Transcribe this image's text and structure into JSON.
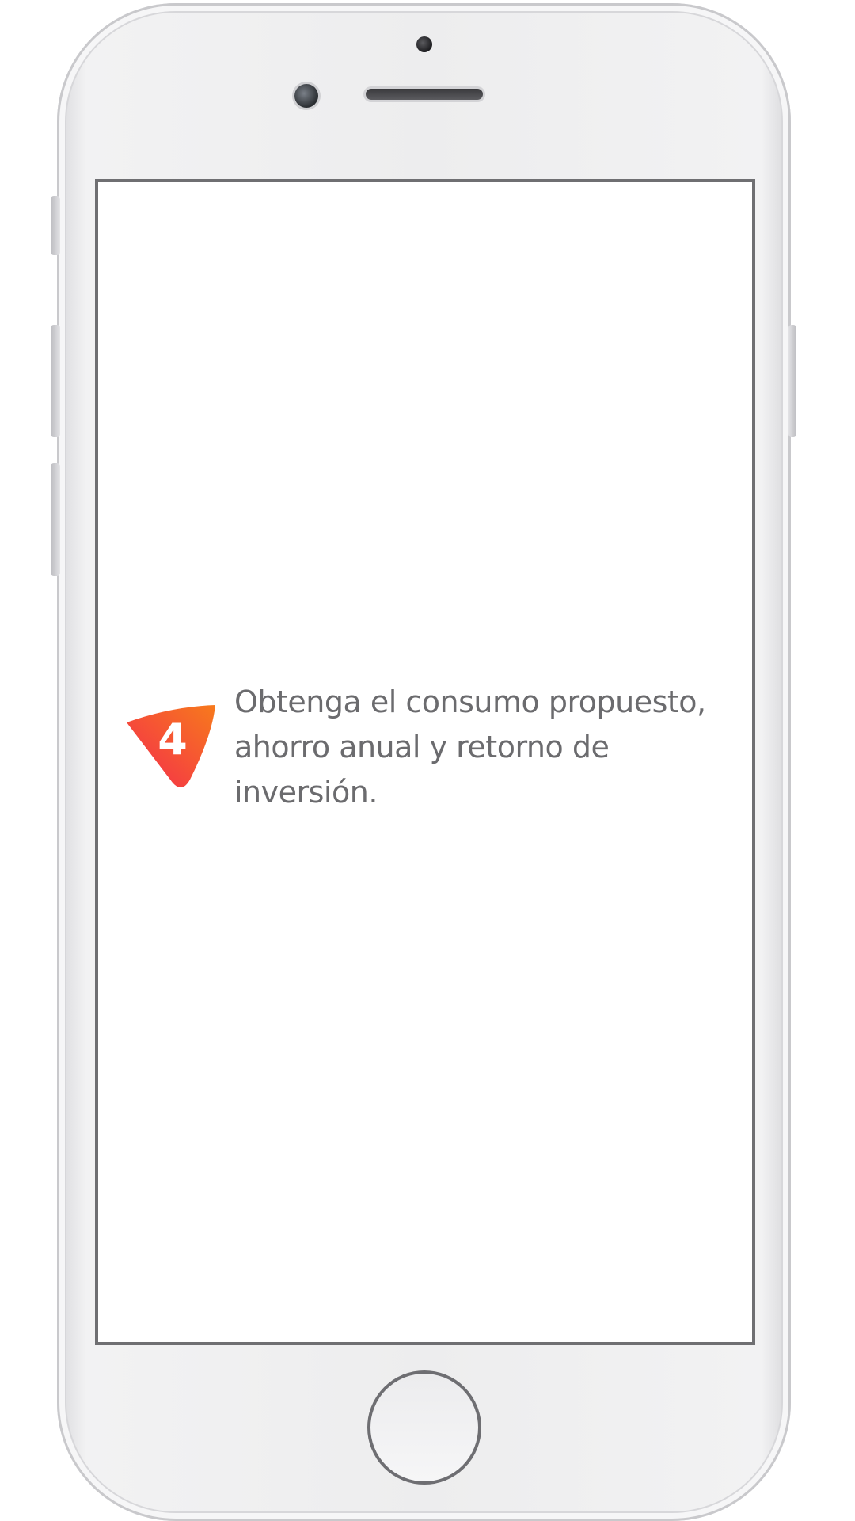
{
  "step": {
    "number": "4",
    "description": "Obtenga el consumo propuesto, ahorro anual y retorno de inversión."
  },
  "colors": {
    "badge_gradient_start": "#f42a4e",
    "badge_gradient_end": "#f77a1c",
    "text": "#6b6b6e"
  },
  "icons": {
    "step_badge": "rounded-triangle-badge"
  }
}
